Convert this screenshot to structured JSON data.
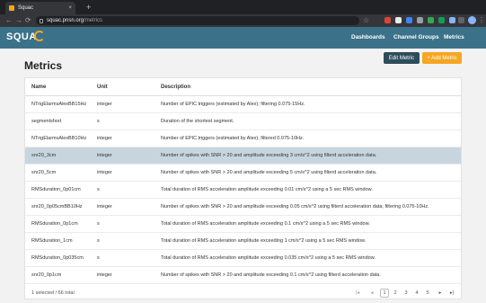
{
  "browser": {
    "tab_title": "Squac",
    "tab_close": "×",
    "new_tab": "+",
    "back": "←",
    "forward": "→",
    "reload": "⟳",
    "url_host": "squac.pnsn.org",
    "url_path": "/metrics",
    "bookmark": "☆",
    "menu": "⋮"
  },
  "app": {
    "logo": "SQUA",
    "nav": {
      "dashboards": "Dashboards",
      "channel_groups": "Channel Groups",
      "metrics": "Metrics"
    }
  },
  "page": {
    "title": "Metrics",
    "edit_button": "Edit Metric",
    "add_button": "+ Add Metric"
  },
  "table": {
    "headers": {
      "name": "Name",
      "unit": "Unit",
      "description": "Description"
    },
    "rows": [
      {
        "name": "NTrigElarmsAlexBB15Hz",
        "unit": "integer",
        "description": "Number of EPIC triggers (estimated by Alex); filtering 0.075-15Hz.",
        "selected": false
      },
      {
        "name": "segmentshort",
        "unit": "s",
        "description": "Duration of the shortest segment.",
        "selected": false
      },
      {
        "name": "NTrigElarmsAlexBB10Hz",
        "unit": "integer",
        "description": "Number of EPIC triggers (estimated by Alex); filtered 0.075-10Hz.",
        "selected": false
      },
      {
        "name": "snr20_3cm",
        "unit": "integer",
        "description": "Number of spikes with SNR > 20 and amplitude exceeding 3 cm/s^2 using filterd acceleration data.",
        "selected": true
      },
      {
        "name": "snr20_5cm",
        "unit": "integer",
        "description": "Number of spikes with SNR > 20 and amplitude exceeding 5 cm/s^2 using filterd acceleration data.",
        "selected": false
      },
      {
        "name": "RMSduration_0p01cm",
        "unit": "s",
        "description": "Total duration of RMS acceleration amplitude exceeding 0.01 cm/s^2 using a 5 sec RMS window.",
        "selected": false
      },
      {
        "name": "snr20_0p05cmBB10Hz",
        "unit": "integer",
        "description": "Number of spikes with SNR > 20 and amplitude exceeding 0.05 cm/s^2 using filterd acceleration data; filtering 0.075-10Hz.",
        "selected": false
      },
      {
        "name": "RMSduration_0p1cm",
        "unit": "s",
        "description": "Total duration of RMS acceleration amplitude exceeding 0.1 cm/s^2 using a 5 sec RMS window.",
        "selected": false
      },
      {
        "name": "RMSduration_1cm",
        "unit": "s",
        "description": "Total duration of RMS acceleration amplitude exceeding 1 cm/s^2 using a 5 sec RMS window.",
        "selected": false
      },
      {
        "name": "RMSduration_0p035cm",
        "unit": "s",
        "description": "Total duration of RMS acceleration amplitude exceeding 0.035 cm/s^2 using a 5 sec RMS window.",
        "selected": false
      },
      {
        "name": "snr20_0p1cm",
        "unit": "integer",
        "description": "Number of spikes with SNR > 20 and amplitude exceeding 0.1 cm/s^2 using filterd acceleration data.",
        "selected": false
      }
    ],
    "footer": {
      "status": "1 selected / 66 total",
      "first": "|◂",
      "prev": "◂",
      "pages": [
        "1",
        "2",
        "3",
        "4",
        "5"
      ],
      "current_page": "1",
      "next": "▸",
      "last": "▸|"
    }
  },
  "colors": {
    "navbar": "#3b7189",
    "accent": "#f5a623",
    "edit_button": "#2e4d5b",
    "selected_row": "#c7d6de"
  }
}
